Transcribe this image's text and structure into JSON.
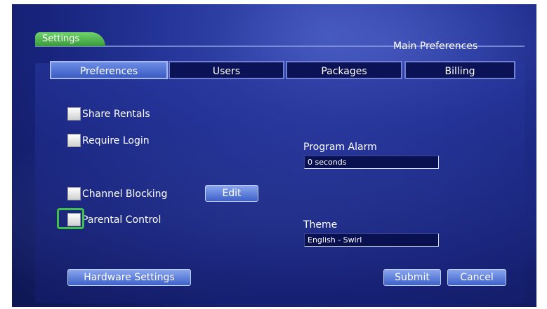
{
  "header": {
    "settings_tab": "Settings",
    "section_title": "Main Preferences"
  },
  "tabs": [
    {
      "label": "Preferences",
      "active": true
    },
    {
      "label": "Users",
      "active": false
    },
    {
      "label": "Packages",
      "active": false
    },
    {
      "label": "Billing",
      "active": false
    }
  ],
  "preferences": {
    "share_rentals": {
      "label": "Share Rentals",
      "checked": false
    },
    "require_login": {
      "label": "Require Login",
      "checked": false
    },
    "channel_blocking": {
      "label": "Channel Blocking",
      "checked": false
    },
    "parental_control": {
      "label": "Parental Control",
      "checked": false,
      "focused": true
    },
    "edit_label": "Edit"
  },
  "program_alarm": {
    "label": "Program Alarm",
    "value": "0 seconds"
  },
  "theme": {
    "label": "Theme",
    "value": "English - Swirl"
  },
  "buttons": {
    "hardware_settings": "Hardware Settings",
    "submit": "Submit",
    "cancel": "Cancel"
  },
  "colors": {
    "focus_highlight": "#3fc24c",
    "settings_tab": "#4fb64d",
    "background": "#1c2a8a"
  }
}
